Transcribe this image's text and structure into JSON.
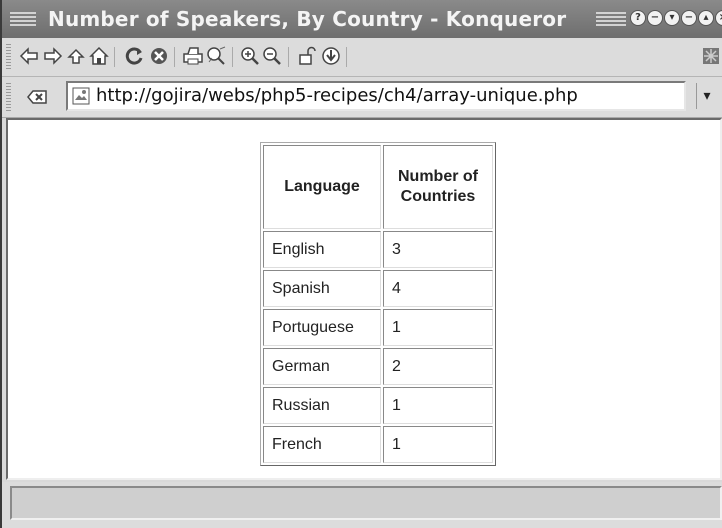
{
  "window": {
    "title": "Number of Speakers, By Country - Konqueror",
    "buttons": [
      "?",
      "−",
      "▾",
      "−",
      "▴",
      "×"
    ]
  },
  "toolbar": {
    "icons": [
      "back-icon",
      "forward-icon",
      "up-icon",
      "home-icon",
      "reload-icon",
      "stop-icon",
      "print-icon",
      "find-icon",
      "zoom-in-icon",
      "zoom-out-icon",
      "security-lock-icon",
      "download-icon"
    ]
  },
  "location": {
    "url": "http://gojira/webs/php5-recipes/ch4/array-unique.php"
  },
  "table": {
    "headers": [
      "Language",
      "Number of Countries"
    ],
    "rows": [
      {
        "language": "English",
        "count": "3"
      },
      {
        "language": "Spanish",
        "count": "4"
      },
      {
        "language": "Portuguese",
        "count": "1"
      },
      {
        "language": "German",
        "count": "2"
      },
      {
        "language": "Russian",
        "count": "1"
      },
      {
        "language": "French",
        "count": "1"
      }
    ]
  },
  "status": {
    "text": ""
  }
}
